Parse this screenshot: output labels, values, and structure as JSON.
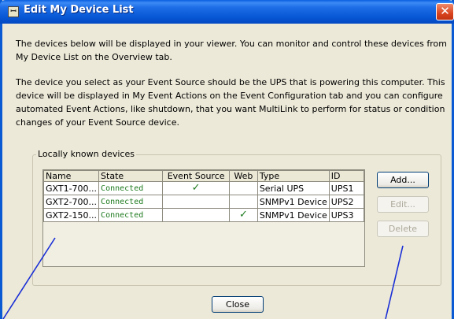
{
  "window": {
    "title": "Edit My Device List",
    "app_icon_glyph": "ꟷ",
    "close_glyph": "✕"
  },
  "intro": {
    "paragraph1": "The devices below will be displayed in your viewer. You can monitor and control these devices from My Device List on the Overview tab.",
    "paragraph2": "The device you select as your Event Source should be the UPS that is powering this computer. This device will be displayed in My Event Actions on the Event Configuration tab and you can configure automated Event Actions, like shutdown, that you want MultiLink to perform for status or condition changes of your Event Source device."
  },
  "devices_group": {
    "label": "Locally known devices",
    "columns": {
      "name": "Name",
      "state": "State",
      "event_source": "Event Source",
      "web": "Web",
      "type": "Type",
      "id": "ID"
    },
    "rows": [
      {
        "name": "GXT1-700...",
        "state": "Connected",
        "event_source": "✓",
        "web": "",
        "type": "Serial UPS",
        "id": "UPS1"
      },
      {
        "name": "GXT2-700...",
        "state": "Connected",
        "event_source": "",
        "web": "",
        "type": "SNMPv1 Device",
        "id": "UPS2"
      },
      {
        "name": "GXT2-150...",
        "state": "Connected",
        "event_source": "",
        "web": "✓",
        "type": "SNMPv1 Device",
        "id": "UPS3"
      }
    ],
    "state_color": "#1d7a1d"
  },
  "buttons": {
    "add": "Add...",
    "edit": "Edit...",
    "delete": "Delete",
    "close": "Close"
  },
  "colors": {
    "titlebar": "#0858d6",
    "window_bg": "#ece9d8",
    "annotation_lines": "#1a2fd6"
  }
}
